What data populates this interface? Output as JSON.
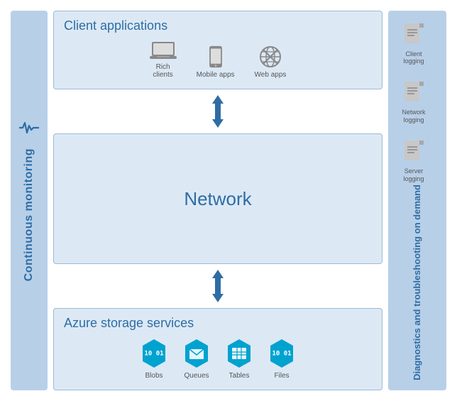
{
  "leftSidebar": {
    "label": "Continuous monitoring"
  },
  "clientApps": {
    "title": "Client applications",
    "icons": [
      {
        "id": "rich-clients",
        "label": "Rich\nclients"
      },
      {
        "id": "mobile-apps",
        "label": "Mobile apps"
      },
      {
        "id": "web-apps",
        "label": "Web apps"
      }
    ]
  },
  "network": {
    "title": "Network"
  },
  "azureStorage": {
    "title": "Azure storage services",
    "icons": [
      {
        "id": "blobs",
        "label": "Blobs",
        "color": "#00a2d0"
      },
      {
        "id": "queues",
        "label": "Queues",
        "color": "#00a2d0"
      },
      {
        "id": "tables",
        "label": "Tables",
        "color": "#00a2d0"
      },
      {
        "id": "files",
        "label": "Files",
        "color": "#00a2d0"
      }
    ]
  },
  "rightSidebar": {
    "label": "Diagnostics and troubleshooting on demand",
    "logs": [
      {
        "id": "client-logging",
        "label": "Client\nlogging"
      },
      {
        "id": "network-logging",
        "label": "Network\nlogging"
      },
      {
        "id": "server-logging",
        "label": "Server\nlogging"
      }
    ]
  }
}
